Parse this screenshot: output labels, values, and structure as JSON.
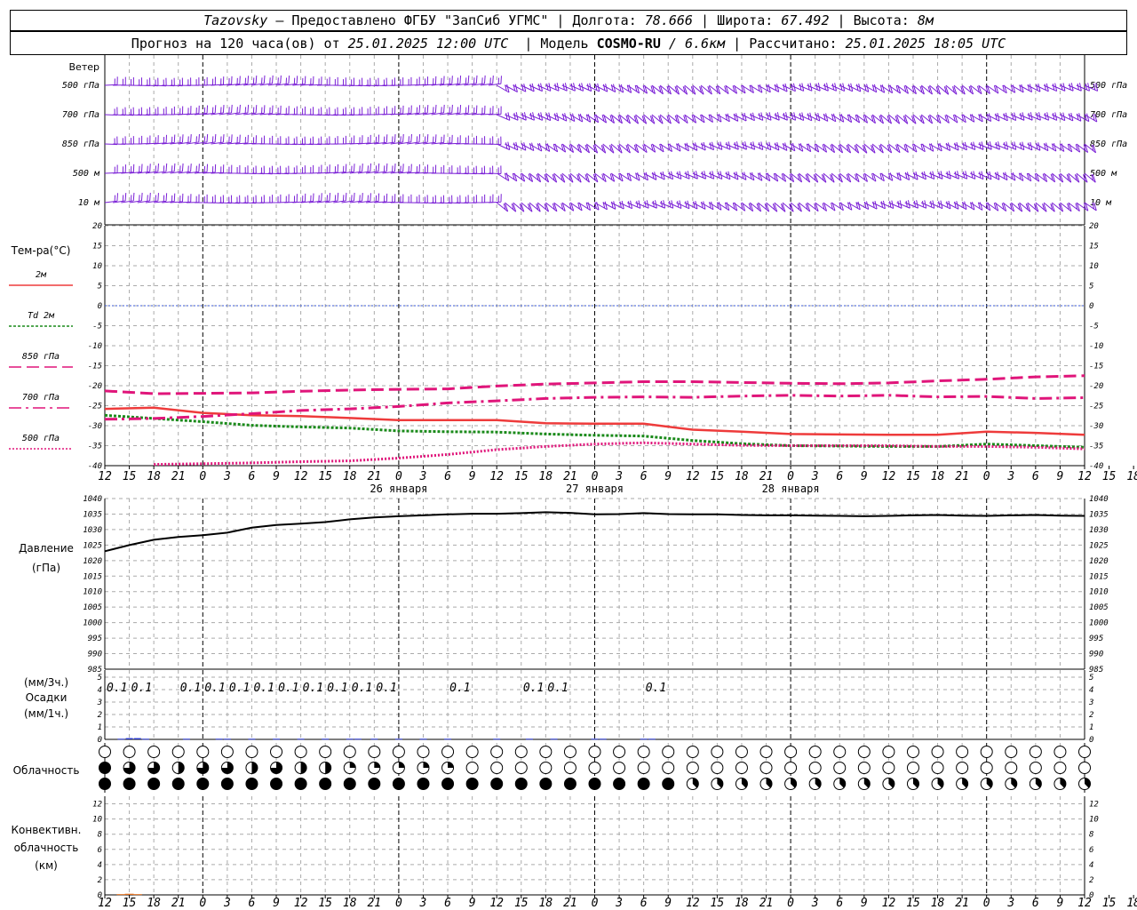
{
  "header": {
    "station": "Tazovsky",
    "provider": "– Предоставлено ФГБУ \"ЗапСиб УГМС\"",
    "lon_label": "Долгота:",
    "lon": "78.666",
    "lat_label": "Широта:",
    "lat": "67.492",
    "alt_label": "Высота:",
    "alt": "8м",
    "forecast_prefix": "Прогноз на 120 часа(ов) от",
    "forecast_time": "25.01.2025 12:00 UTC",
    "model_label": "Модель",
    "model": "COSMO-RU",
    "resolution": "/ 6.6км",
    "calc_label": "Рассчитано:",
    "calc_time": "25.01.2025 18:05 UTC"
  },
  "chart_data": [
    {
      "type": "wind-barbs",
      "title": "Ветер",
      "levels": [
        "500 гПа",
        "700 гПа",
        "850 гПа",
        "500 м",
        "10  м"
      ],
      "x_hours": [
        0,
        120
      ]
    },
    {
      "type": "line",
      "title": "Тем-ра(°C)",
      "ylim": [
        -40,
        20
      ],
      "yticks": [
        -40,
        -35,
        -30,
        -25,
        -20,
        -15,
        -10,
        -5,
        0,
        5,
        10,
        15,
        20
      ],
      "x_hours_step": 3,
      "series": [
        {
          "name": "2м",
          "color": "#ee3b3b",
          "style": "solid",
          "x": [
            0,
            6,
            12,
            18,
            24,
            30,
            36,
            42,
            48,
            54,
            60,
            66,
            72,
            78,
            84,
            90,
            96,
            102,
            108,
            114,
            120
          ],
          "values": [
            -25.8,
            -25.5,
            -26.8,
            -27.4,
            -27.6,
            -28.1,
            -28.6,
            -28.6,
            -28.6,
            -29.4,
            -29.5,
            -29.5,
            -31.0,
            -31.5,
            -32.1,
            -32.2,
            -32.3,
            -32.3,
            -31.5,
            -31.8,
            -32.3
          ]
        },
        {
          "name": "Td  2м",
          "color": "#1a8a1a",
          "style": "dotted",
          "x": [
            0,
            6,
            12,
            18,
            24,
            30,
            36,
            42,
            48,
            54,
            60,
            66,
            72,
            78,
            84,
            90,
            96,
            102,
            108,
            114,
            120
          ],
          "values": [
            -27.4,
            -28.2,
            -29.0,
            -29.9,
            -30.3,
            -30.6,
            -31.3,
            -31.5,
            -31.6,
            -32.1,
            -32.4,
            -32.6,
            -33.7,
            -34.5,
            -35.0,
            -35.1,
            -35.2,
            -35.2,
            -34.6,
            -35.0,
            -35.4
          ]
        },
        {
          "name": "850 гПа",
          "color": "#e0157a",
          "style": "dash",
          "x": [
            0,
            6,
            12,
            18,
            24,
            30,
            36,
            42,
            48,
            54,
            60,
            66,
            72,
            78,
            84,
            90,
            96,
            102,
            108,
            114,
            120
          ],
          "values": [
            -21.3,
            -22.0,
            -21.9,
            -21.8,
            -21.4,
            -21.1,
            -20.9,
            -20.8,
            -20.1,
            -19.6,
            -19.3,
            -19.0,
            -19.0,
            -19.2,
            -19.4,
            -19.5,
            -19.3,
            -18.8,
            -18.4,
            -17.8,
            -17.5
          ]
        },
        {
          "name": "700 гПа",
          "color": "#e0157a",
          "style": "dashdot",
          "x": [
            0,
            6,
            12,
            18,
            24,
            30,
            36,
            42,
            48,
            54,
            60,
            66,
            72,
            78,
            84,
            90,
            96,
            102,
            108,
            114,
            120
          ],
          "values": [
            -28.4,
            -28.2,
            -27.7,
            -27.0,
            -26.2,
            -25.8,
            -25.2,
            -24.3,
            -23.8,
            -23.2,
            -22.9,
            -22.8,
            -22.9,
            -22.6,
            -22.4,
            -22.6,
            -22.4,
            -22.8,
            -22.7,
            -23.2,
            -23.0
          ]
        },
        {
          "name": "500 гПа",
          "color": "#e0157a",
          "style": "densedot",
          "x": [
            6,
            12,
            18,
            24,
            30,
            36,
            42,
            48,
            54,
            60,
            66,
            72,
            78,
            84,
            90,
            96,
            102,
            108,
            114,
            120
          ],
          "values": [
            -39.7,
            -39.5,
            -39.3,
            -39.0,
            -38.8,
            -38.1,
            -37.2,
            -36.0,
            -35.2,
            -34.6,
            -34.3,
            -34.6,
            -34.9,
            -35.0,
            -35.0,
            -35.0,
            -35.2,
            -35.2,
            -35.4,
            -35.8
          ]
        }
      ]
    },
    {
      "type": "line",
      "title": "Давление",
      "ylabel": "(гПа)",
      "ylim": [
        985,
        1040
      ],
      "yticks": [
        985,
        990,
        995,
        1000,
        1005,
        1010,
        1015,
        1020,
        1025,
        1030,
        1035,
        1040
      ],
      "series": [
        {
          "name": "",
          "color": "#000000",
          "x": [
            0,
            3,
            6,
            9,
            12,
            15,
            18,
            21,
            24,
            27,
            30,
            33,
            36,
            39,
            42,
            45,
            48,
            51,
            54,
            57,
            60,
            63,
            66,
            69,
            72,
            75,
            78,
            81,
            84,
            87,
            90,
            93,
            96,
            99,
            102,
            105,
            108,
            111,
            114,
            117,
            120
          ],
          "values": [
            1023.0,
            1025.0,
            1026.7,
            1027.6,
            1028.2,
            1029.0,
            1030.6,
            1031.5,
            1031.9,
            1032.4,
            1033.3,
            1033.9,
            1034.3,
            1034.6,
            1034.9,
            1035.1,
            1035.1,
            1035.3,
            1035.6,
            1035.4,
            1034.9,
            1035.0,
            1035.3,
            1035.0,
            1034.9,
            1034.9,
            1034.7,
            1034.6,
            1034.6,
            1034.5,
            1034.4,
            1034.3,
            1034.4,
            1034.6,
            1034.7,
            1034.5,
            1034.4,
            1034.6,
            1034.7,
            1034.5,
            1034.4
          ]
        }
      ]
    },
    {
      "type": "bar",
      "title": "Осадки",
      "ylabel_top": "(мм/3ч.)",
      "ylabel_bottom": "(мм/1ч.)",
      "ylim": [
        0,
        5
      ],
      "yticks": [
        0,
        1,
        2,
        3,
        4,
        5
      ],
      "labels_3h": [
        {
          "hour": 1.5,
          "text": "0.1"
        },
        {
          "hour": 4.5,
          "text": "0.1"
        },
        {
          "hour": 10.5,
          "text": "0.1"
        },
        {
          "hour": 13.5,
          "text": "0.1"
        },
        {
          "hour": 16.5,
          "text": "0.1"
        },
        {
          "hour": 19.5,
          "text": "0.1"
        },
        {
          "hour": 22.5,
          "text": "0.1"
        },
        {
          "hour": 25.5,
          "text": "0.1"
        },
        {
          "hour": 28.5,
          "text": "0.1"
        },
        {
          "hour": 31.5,
          "text": "0.1"
        },
        {
          "hour": 34.5,
          "text": "0.1"
        },
        {
          "hour": 43.5,
          "text": "0.1"
        },
        {
          "hour": 52.5,
          "text": "0.1"
        },
        {
          "hour": 55.5,
          "text": "0.1"
        },
        {
          "hour": 67.5,
          "text": "0.1"
        }
      ],
      "bars_1h": {
        "hours": [
          2,
          3,
          4,
          5,
          10,
          14,
          15,
          18,
          21,
          24,
          27,
          30,
          31,
          33,
          36,
          39,
          42,
          48,
          52,
          55,
          60,
          61,
          66,
          67
        ],
        "values": [
          0.05,
          0.1,
          0.1,
          0.05,
          0.05,
          0.05,
          0.05,
          0.05,
          0.05,
          0.05,
          0.05,
          0.05,
          0.05,
          0.05,
          0.05,
          0.05,
          0.05,
          0.05,
          0.05,
          0.05,
          0.05,
          0.05,
          0.05,
          0.05
        ]
      }
    },
    {
      "type": "symbols",
      "title": "Облачность",
      "rows": [
        "high",
        "middle",
        "low"
      ],
      "fractions": {
        "high": [
          0,
          0,
          0,
          0,
          0,
          0,
          0,
          0,
          0,
          0,
          0,
          0,
          0,
          0,
          0,
          0,
          0,
          0,
          0,
          0,
          0,
          0,
          0,
          0,
          0,
          0,
          0,
          0,
          0,
          0,
          0,
          0,
          0,
          0,
          0,
          0,
          0,
          0,
          0,
          0,
          0,
          0,
          0,
          0,
          0,
          0,
          0,
          0,
          0,
          0,
          0,
          0,
          0,
          0,
          0,
          0,
          0,
          0,
          0,
          0,
          0,
          0,
          0,
          0,
          0,
          0,
          0,
          0,
          0,
          0,
          0,
          0,
          0,
          0,
          0,
          0,
          0,
          0,
          0,
          0,
          0,
          0,
          0,
          0,
          0,
          0,
          0,
          0,
          0,
          0,
          0,
          0,
          0,
          0,
          0,
          0,
          0,
          0,
          0,
          0,
          0,
          0,
          0,
          0,
          0,
          0,
          0,
          0,
          0,
          0,
          0,
          0,
          0,
          0,
          0,
          0,
          0,
          0,
          0,
          0,
          0
        ],
        "middle": [
          1,
          0.75,
          0.75,
          0.5,
          0.75,
          0.75,
          0.5,
          0.75,
          0.5,
          0.5,
          0.25,
          0.25,
          0.25,
          0.25,
          0.25,
          0,
          0,
          0,
          0,
          0,
          0,
          0,
          0,
          0,
          0,
          0,
          0,
          0,
          0,
          0,
          0,
          0,
          0,
          0,
          0,
          0,
          0,
          0,
          0,
          0,
          0,
          0,
          0,
          0,
          0,
          0,
          0,
          0,
          0,
          0,
          0,
          0,
          0,
          0,
          0,
          0,
          0,
          0,
          0,
          0,
          0,
          0,
          0,
          0,
          0,
          0,
          0,
          0,
          0,
          0,
          0,
          0,
          0,
          0,
          0,
          0,
          0,
          0,
          0,
          0,
          0,
          0,
          0,
          0,
          0,
          0,
          0,
          0,
          0,
          0,
          0,
          0,
          0,
          0,
          0,
          0,
          0,
          0,
          0,
          0,
          0,
          0,
          0,
          0,
          0,
          0,
          0,
          0,
          0,
          0,
          0,
          0,
          0,
          0,
          0,
          0,
          0,
          0,
          0,
          0,
          0
        ],
        "low": "1 for hours 0–69, 0.375 (split) for hours 70–120"
      }
    },
    {
      "type": "bar",
      "title": "Конвективн. облачность",
      "ylabel": "(км)",
      "ylim": [
        0,
        13
      ],
      "yticks": [
        0,
        2,
        4,
        6,
        8,
        10,
        12
      ],
      "bars": {
        "hours": [
          2,
          3,
          4
        ],
        "values": [
          0.1,
          0.15,
          0.1
        ]
      }
    }
  ],
  "axis": {
    "hour_labels": [
      "12",
      "15",
      "18",
      "21",
      "0",
      "3",
      "6",
      "9",
      "12",
      "15",
      "18",
      "21",
      "0",
      "3",
      "6",
      "9",
      "12",
      "15",
      "18",
      "21",
      "0",
      "3",
      "6",
      "9",
      "12",
      "15",
      "18",
      "21",
      "0",
      "3",
      "6",
      "9",
      "12",
      "15",
      "18",
      "21",
      "0",
      "3",
      "6",
      "9",
      "12",
      "15",
      "18"
    ],
    "dates": [
      {
        "hour": 36,
        "text": "26 января"
      },
      {
        "hour": 60,
        "text": "27 января"
      },
      {
        "hour": 84,
        "text": "28 января"
      }
    ],
    "midnights": [
      12,
      36,
      60,
      84,
      108
    ]
  },
  "colors": {
    "wind": "#7a1fd6",
    "grid": "#aaaaaa",
    "zero_line": "#3a5ad9",
    "precip": "#2233cc",
    "convective": "#e07020"
  }
}
